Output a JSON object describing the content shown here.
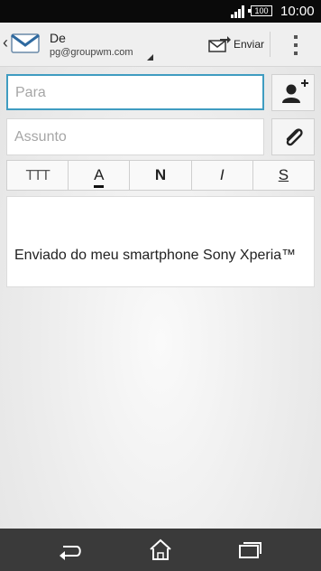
{
  "status": {
    "time": "10:00",
    "battery": "100"
  },
  "header": {
    "from_label": "De",
    "account": "pg@groupwm.com",
    "send_label": "Enviar"
  },
  "to": {
    "placeholder": "Para"
  },
  "subject": {
    "placeholder": "Assunto"
  },
  "format": {
    "size_label": "TTT",
    "color_label": "A",
    "bold_label": "N",
    "italic_label": "I",
    "strike_label": "S"
  },
  "body": {
    "signature": "Enviado do meu smartphone Sony Xperia™"
  },
  "colors": {
    "accent": "#3f9cc1",
    "statusbar": "#0a0a0a",
    "navbar": "#3a3a3a"
  }
}
